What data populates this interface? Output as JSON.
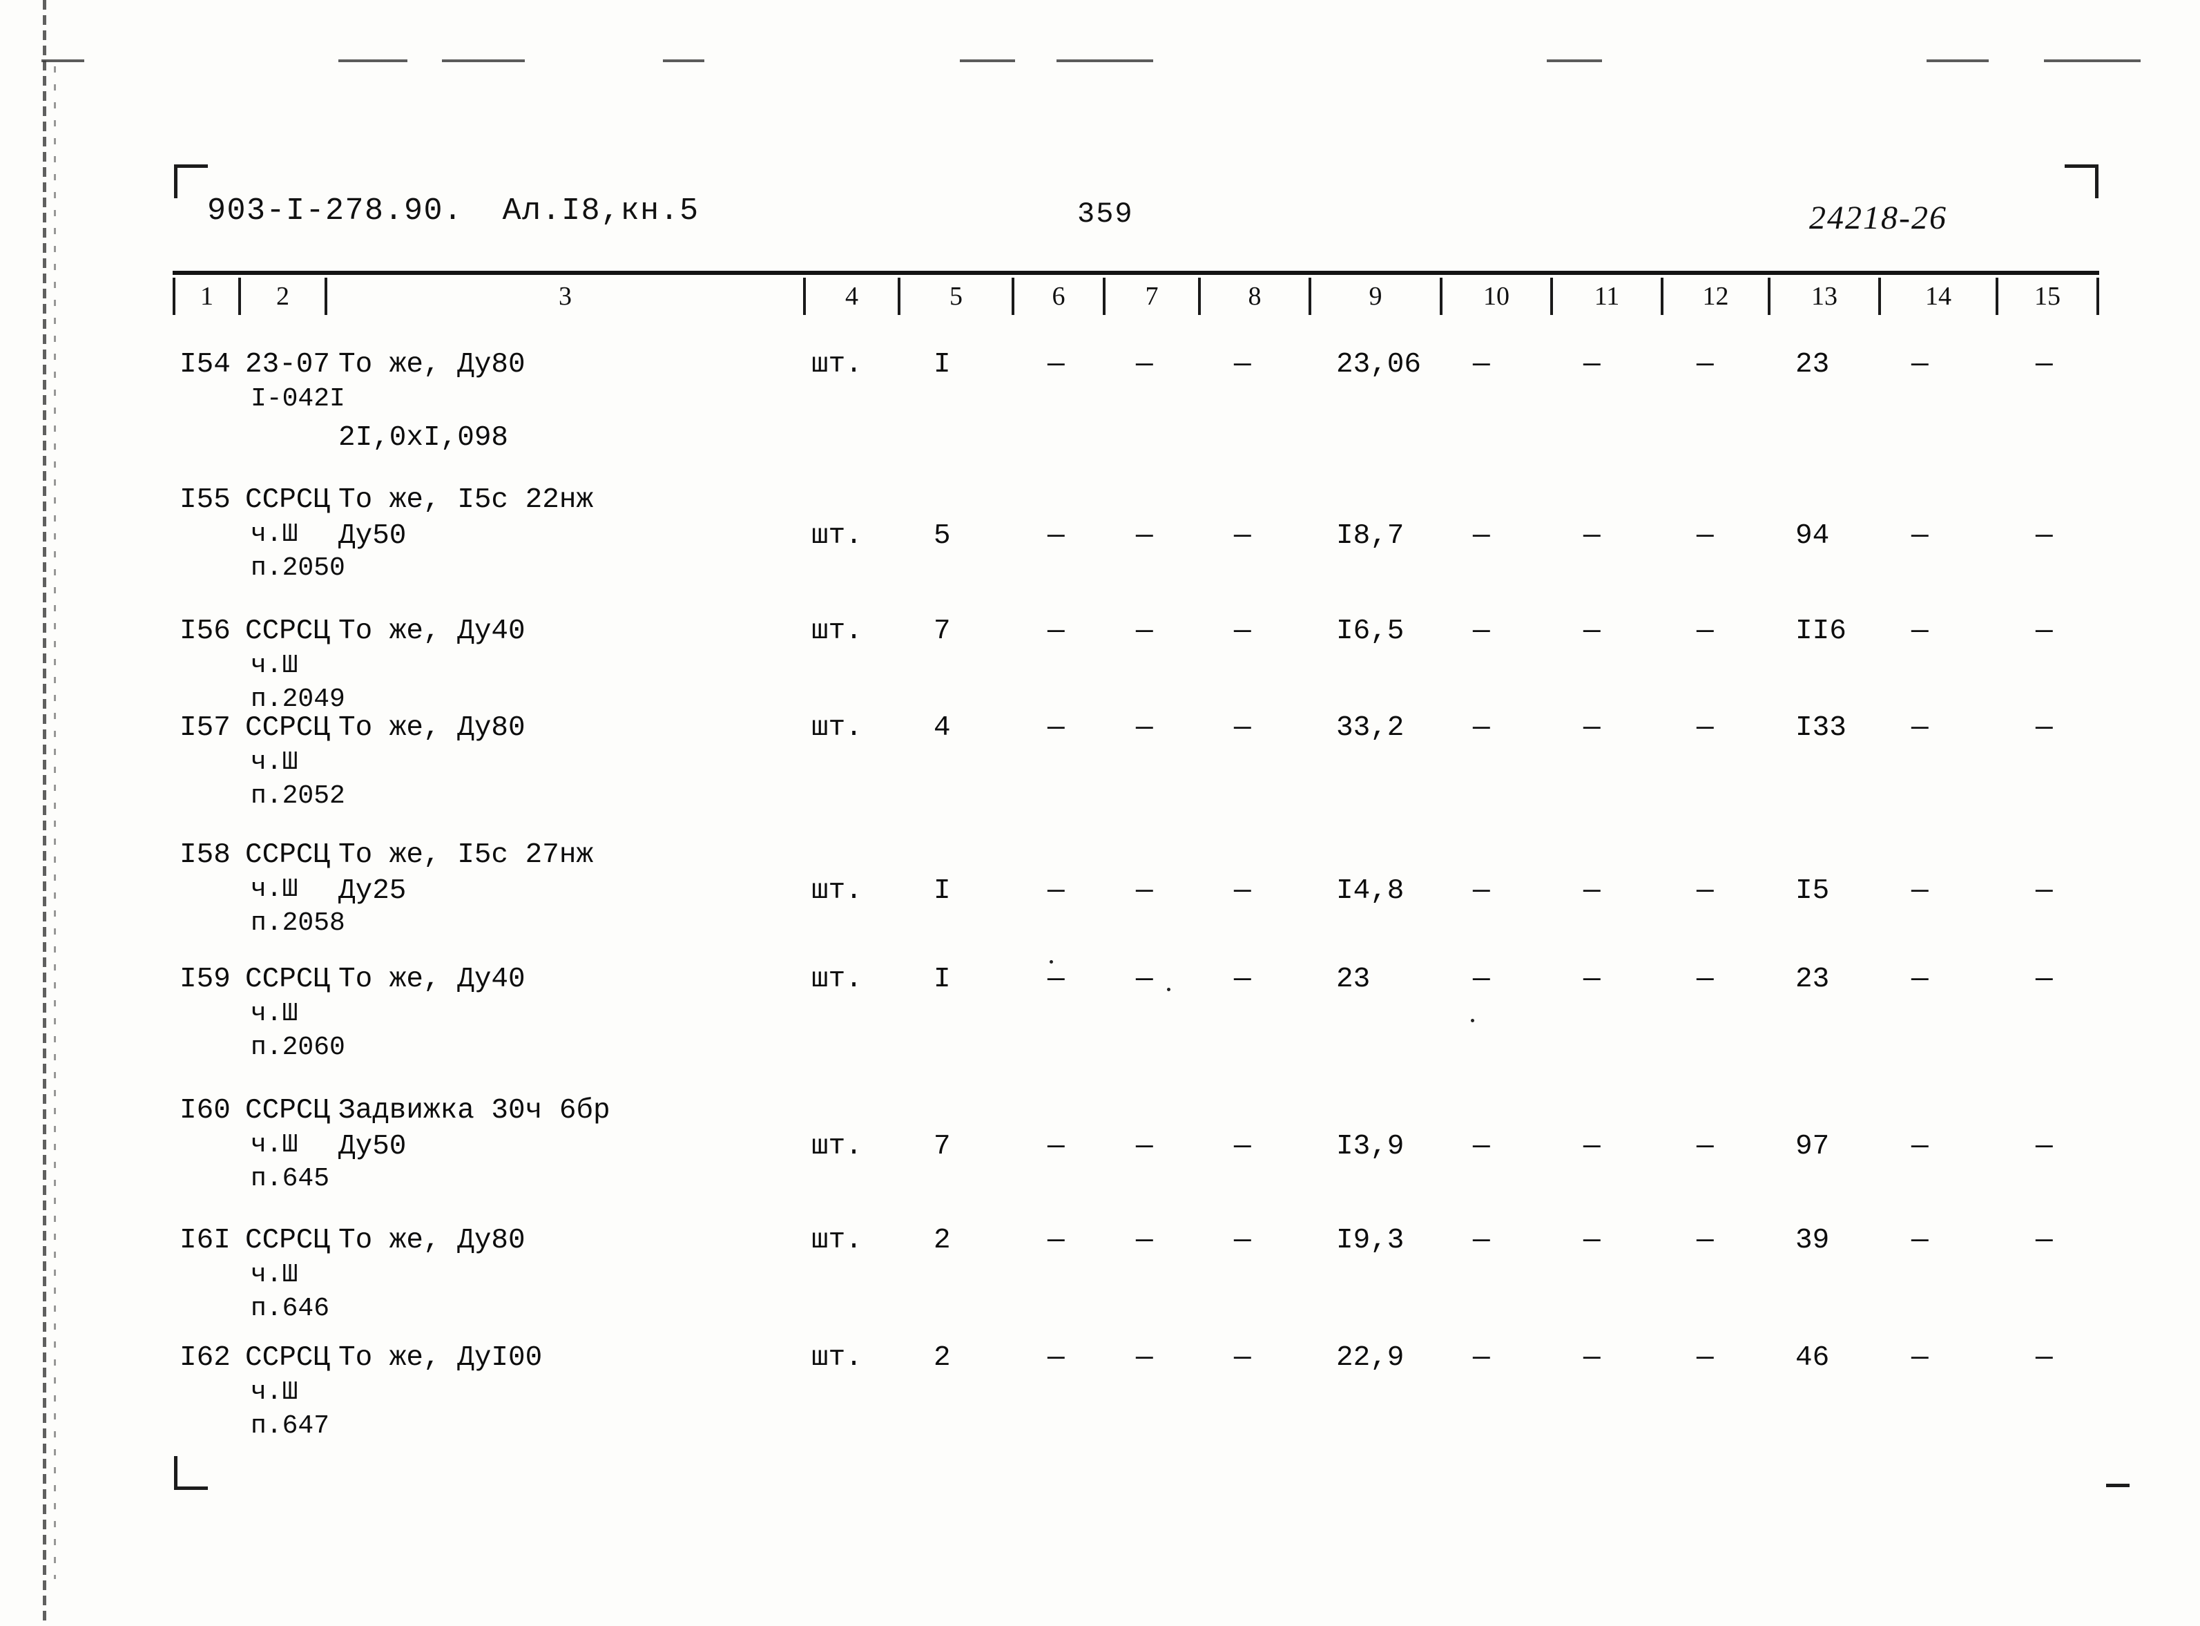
{
  "header": {
    "doc_code": "903-I-278.90.  Ал.I8,кн.5",
    "page_number": "359",
    "sheet_stamp": "24218-26"
  },
  "table": {
    "column_headers": [
      "1",
      "2",
      "3",
      "4",
      "5",
      "6",
      "7",
      "8",
      "9",
      "10",
      "11",
      "12",
      "13",
      "14",
      "15"
    ],
    "dash": "—",
    "rows": [
      {
        "pos": "I54",
        "code": "23-07\nI-042I",
        "name": "То же, Ду80",
        "name2": "2I,0xI,098",
        "unit": "шт.",
        "qty": "I",
        "c6": "—",
        "c7": "—",
        "c8": "—",
        "c9": "23,06",
        "c10": "—",
        "c11": "—",
        "c12": "—",
        "c13": "23",
        "c14": "—",
        "c15": "—"
      },
      {
        "pos": "I55",
        "code": "ССРСЦ\nч.Ш\nп.2050",
        "name": "То же, I5с 22нж",
        "name2": "Ду50",
        "unit": "шт.",
        "qty": "5",
        "c6": "—",
        "c7": "—",
        "c8": "—",
        "c9": "I8,7",
        "c10": "—",
        "c11": "—",
        "c12": "—",
        "c13": "94",
        "c14": "—",
        "c15": "—"
      },
      {
        "pos": "I56",
        "code": "ССРСЦ\nч.Ш\nп.2049",
        "name": "То же, Ду40",
        "name2": "",
        "unit": "шт.",
        "qty": "7",
        "c6": "—",
        "c7": "—",
        "c8": "—",
        "c9": "I6,5",
        "c10": "—",
        "c11": "—",
        "c12": "—",
        "c13": "II6",
        "c14": "—",
        "c15": "—"
      },
      {
        "pos": "I57",
        "code": "ССРСЦ\nч.Ш\nп.2052",
        "name": "То же, Ду80",
        "name2": "",
        "unit": "шт.",
        "qty": "4",
        "c6": "—",
        "c7": "—",
        "c8": "—",
        "c9": "33,2",
        "c10": "—",
        "c11": "—",
        "c12": "—",
        "c13": "I33",
        "c14": "—",
        "c15": "—"
      },
      {
        "pos": "I58",
        "code": "ССРСЦ\nч.Ш\nп.2058",
        "name": "То же, I5с 27нж",
        "name2": "Ду25",
        "unit": "шт.",
        "qty": "I",
        "c6": "—",
        "c7": "—",
        "c8": "—",
        "c9": "I4,8",
        "c10": "—",
        "c11": "—",
        "c12": "—",
        "c13": "I5",
        "c14": "—",
        "c15": "—"
      },
      {
        "pos": "I59",
        "code": "ССРСЦ\nч.Ш\nп.2060",
        "name": "То же, Ду40",
        "name2": "",
        "unit": "шт.",
        "qty": "I",
        "c6": "—",
        "c7": "—",
        "c8": "—",
        "c9": "23",
        "c10": "—",
        "c11": "—",
        "c12": "—",
        "c13": "23",
        "c14": "—",
        "c15": "—"
      },
      {
        "pos": "I60",
        "code": "ССРСЦ\nч.Ш\nп.645",
        "name": "Задвижка 30ч 6бр",
        "name2": "Ду50",
        "unit": "шт.",
        "qty": "7",
        "c6": "—",
        "c7": "—",
        "c8": "—",
        "c9": "I3,9",
        "c10": "—",
        "c11": "—",
        "c12": "—",
        "c13": "97",
        "c14": "—",
        "c15": "—"
      },
      {
        "pos": "I6I",
        "code": "ССРСЦ\nч.Ш\nп.646",
        "name": "То же, Ду80",
        "name2": "",
        "unit": "шт.",
        "qty": "2",
        "c6": "—",
        "c7": "—",
        "c8": "—",
        "c9": "I9,3",
        "c10": "—",
        "c11": "—",
        "c12": "—",
        "c13": "39",
        "c14": "—",
        "c15": "—"
      },
      {
        "pos": "I62",
        "code": "ССРСЦ\nч.Ш\nп.647",
        "name": "То же, ДуI00",
        "name2": "",
        "unit": "шт.",
        "qty": "2",
        "c6": "—",
        "c7": "—",
        "c8": "—",
        "c9": "22,9",
        "c10": "—",
        "c11": "—",
        "c12": "—",
        "c13": "46",
        "c14": "—",
        "c15": "—"
      }
    ]
  }
}
